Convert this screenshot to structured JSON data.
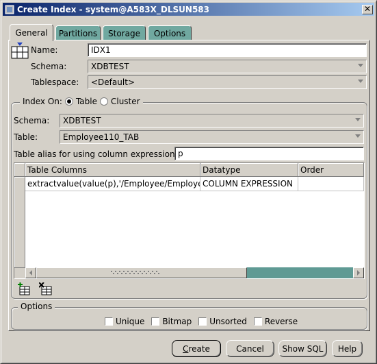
{
  "window": {
    "title": "Create Index - system@A583X_DLSUN583",
    "close_glyph": "✕"
  },
  "tabs": [
    {
      "label": "General",
      "active": true
    },
    {
      "label": "Partitions",
      "active": false
    },
    {
      "label": "Storage",
      "active": false
    },
    {
      "label": "Options",
      "active": false
    }
  ],
  "general": {
    "name_label": "Name:",
    "name_value": "IDX1",
    "schema_label": "Schema:",
    "schema_value": "XDBTEST",
    "tablespace_label": "Tablespace:",
    "tablespace_value": "<Default>"
  },
  "index_on": {
    "label": "Index On:",
    "option_table": "Table",
    "option_cluster": "Cluster",
    "selected": "Table",
    "schema_label": "Schema:",
    "schema_value": "XDBTEST",
    "table_label": "Table:",
    "table_value": "Employee110_TAB",
    "alias_label": "Table alias for using column expression:",
    "alias_value": "p"
  },
  "columns_table": {
    "headers": [
      "Table Columns",
      "Datatype",
      "Order"
    ],
    "rows": [
      [
        "extractvalue(value(p),'/Employee/EmployeeId')",
        "COLUMN EXPRESSION",
        ""
      ]
    ]
  },
  "options": {
    "title": "Options",
    "unique": "Unique",
    "bitmap": "Bitmap",
    "unsorted": "Unsorted",
    "reverse": "Reverse"
  },
  "buttons": {
    "create_mnemonic": "C",
    "create_rest": "reate",
    "cancel": "Cancel",
    "show_sql": "Show SQL",
    "help": "Help"
  },
  "colors": {
    "title_gradient_start": "#0a246a",
    "title_gradient_end": "#a6caf0",
    "face": "#d4d0c8",
    "inactive_tab": "#70a8a0",
    "scrollbar_thumb": "#5f9a94"
  }
}
